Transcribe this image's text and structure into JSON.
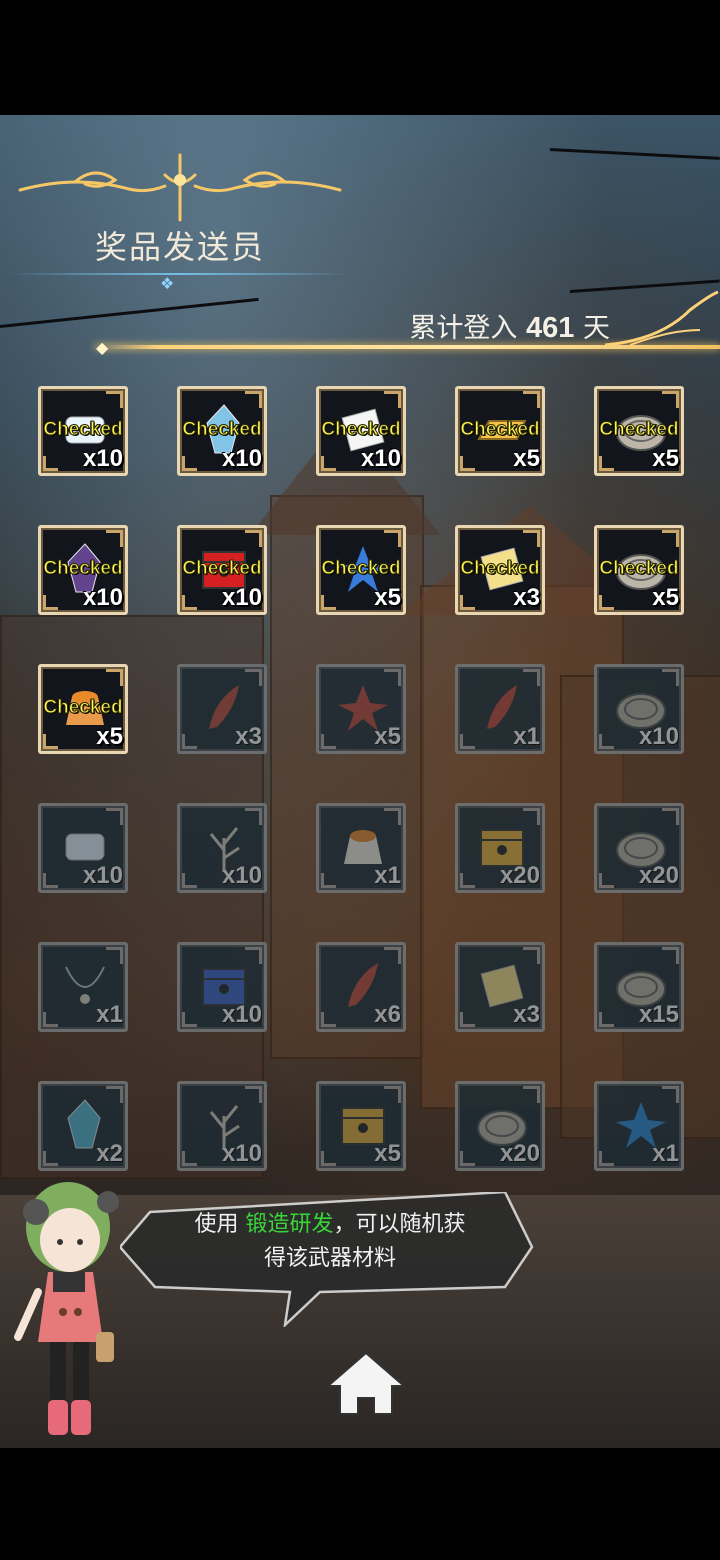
{
  "header": {
    "title": "奖品发送员",
    "login_prefix": "累计登入",
    "login_days": "461",
    "login_suffix": "天"
  },
  "rewards": [
    {
      "icon": "diamond-stack-icon",
      "qty": "x10",
      "status": "Checked",
      "claimed": true,
      "color": "#e9f4ff"
    },
    {
      "icon": "crystal-icon",
      "qty": "x10",
      "status": "Checked",
      "claimed": true,
      "color": "#8fd6ff"
    },
    {
      "icon": "scroll-icon",
      "qty": "x10",
      "status": "Checked",
      "claimed": true,
      "color": "#f5f5f5"
    },
    {
      "icon": "gold-bar-icon",
      "qty": "x5",
      "status": "Checked",
      "claimed": true,
      "color": "#f2c24a"
    },
    {
      "icon": "silver-coin-icon",
      "qty": "x5",
      "status": "Checked",
      "claimed": true,
      "color": "#bdb6a8"
    },
    {
      "icon": "dark-gem-icon",
      "qty": "x10",
      "status": "Checked",
      "claimed": true,
      "color": "#6a4a9a"
    },
    {
      "icon": "red-box-icon",
      "qty": "x10",
      "status": "Checked",
      "claimed": true,
      "color": "#d42020"
    },
    {
      "icon": "blue-leaf-icon",
      "qty": "x5",
      "status": "Checked",
      "claimed": true,
      "color": "#3a7ad8"
    },
    {
      "icon": "ticket-icon",
      "qty": "x3",
      "status": "Checked",
      "claimed": true,
      "color": "#f4e08a"
    },
    {
      "icon": "silver-coin-icon",
      "qty": "x5",
      "status": "Checked",
      "claimed": true,
      "color": "#bdb6a8"
    },
    {
      "icon": "pie-icon",
      "qty": "x5",
      "status": "Checked",
      "claimed": true,
      "color": "#e89a4a"
    },
    {
      "icon": "feather-icon",
      "qty": "x3",
      "status": "",
      "claimed": false,
      "color": "#c04a3a"
    },
    {
      "icon": "red-leaf-icon",
      "qty": "x5",
      "status": "",
      "claimed": false,
      "color": "#c0483a"
    },
    {
      "icon": "claw-icon",
      "qty": "x1",
      "status": "",
      "claimed": false,
      "color": "#c0483a"
    },
    {
      "icon": "silver-coin-icon",
      "qty": "x10",
      "status": "",
      "claimed": false,
      "color": "#bdb6a8"
    },
    {
      "icon": "diamond-stack-icon",
      "qty": "x10",
      "status": "",
      "claimed": false,
      "color": "#e9f4ff"
    },
    {
      "icon": "branch-icon",
      "qty": "x10",
      "status": "",
      "claimed": false,
      "color": "#d8cfc0"
    },
    {
      "icon": "pudding-icon",
      "qty": "x1",
      "status": "",
      "claimed": false,
      "color": "#f4efe0"
    },
    {
      "icon": "gold-chest-icon",
      "qty": "x20",
      "status": "",
      "claimed": false,
      "color": "#e9b23a"
    },
    {
      "icon": "silver-coin-icon",
      "qty": "x20",
      "status": "",
      "claimed": false,
      "color": "#bdb6a8"
    },
    {
      "icon": "necklace-icon",
      "qty": "x1",
      "status": "",
      "claimed": false,
      "color": "#b8c0c8"
    },
    {
      "icon": "blue-chest-icon",
      "qty": "x10",
      "status": "",
      "claimed": false,
      "color": "#3a62c8"
    },
    {
      "icon": "feather-icon",
      "qty": "x6",
      "status": "",
      "claimed": false,
      "color": "#c04a3a"
    },
    {
      "icon": "ticket-icon",
      "qty": "x3",
      "status": "",
      "claimed": false,
      "color": "#f4e08a"
    },
    {
      "icon": "silver-coin-icon",
      "qty": "x15",
      "status": "",
      "claimed": false,
      "color": "#bdb6a8"
    },
    {
      "icon": "ice-cube-icon",
      "qty": "x2",
      "status": "",
      "claimed": false,
      "color": "#5ac8e8"
    },
    {
      "icon": "branch-icon",
      "qty": "x10",
      "status": "",
      "claimed": false,
      "color": "#d8cfc0"
    },
    {
      "icon": "gold-chest-icon",
      "qty": "x5",
      "status": "",
      "claimed": false,
      "color": "#e9b23a"
    },
    {
      "icon": "silver-coin-icon",
      "qty": "x20",
      "status": "",
      "claimed": false,
      "color": "#bdb6a8"
    },
    {
      "icon": "blue-bat-icon",
      "qty": "x1",
      "status": "",
      "claimed": false,
      "color": "#2a8ad8"
    }
  ],
  "tip": {
    "line1_prefix": "使用",
    "highlight": "锻造研发",
    "line1_suffix": "，可以随机获",
    "line2": "得该武器材料",
    "highlight_color": "#39d63a"
  },
  "colors": {
    "gold": "#ffd27a",
    "checked_text": "#fff45a"
  }
}
